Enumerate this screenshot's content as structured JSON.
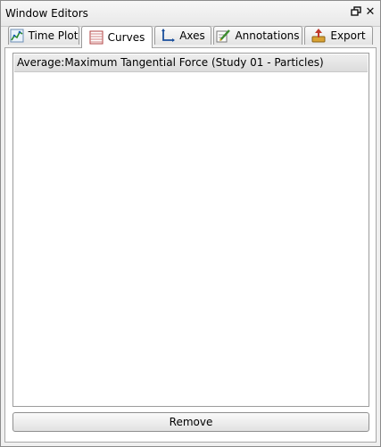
{
  "window": {
    "title": "Window Editors",
    "float_icon": "float-window-icon",
    "close_icon": "close-icon"
  },
  "tabs": [
    {
      "label": "Time Plot",
      "icon": "time-plot-icon",
      "active": false
    },
    {
      "label": "Curves",
      "icon": "curves-icon",
      "active": true
    },
    {
      "label": "Axes",
      "icon": "axes-icon",
      "active": false
    },
    {
      "label": "Annotations",
      "icon": "annotations-icon",
      "active": false
    },
    {
      "label": "Export",
      "icon": "export-icon",
      "active": false
    }
  ],
  "curves": {
    "items": [
      "Average:Maximum Tangential Force (Study 01 - Particles)"
    ],
    "remove_label": "Remove"
  }
}
